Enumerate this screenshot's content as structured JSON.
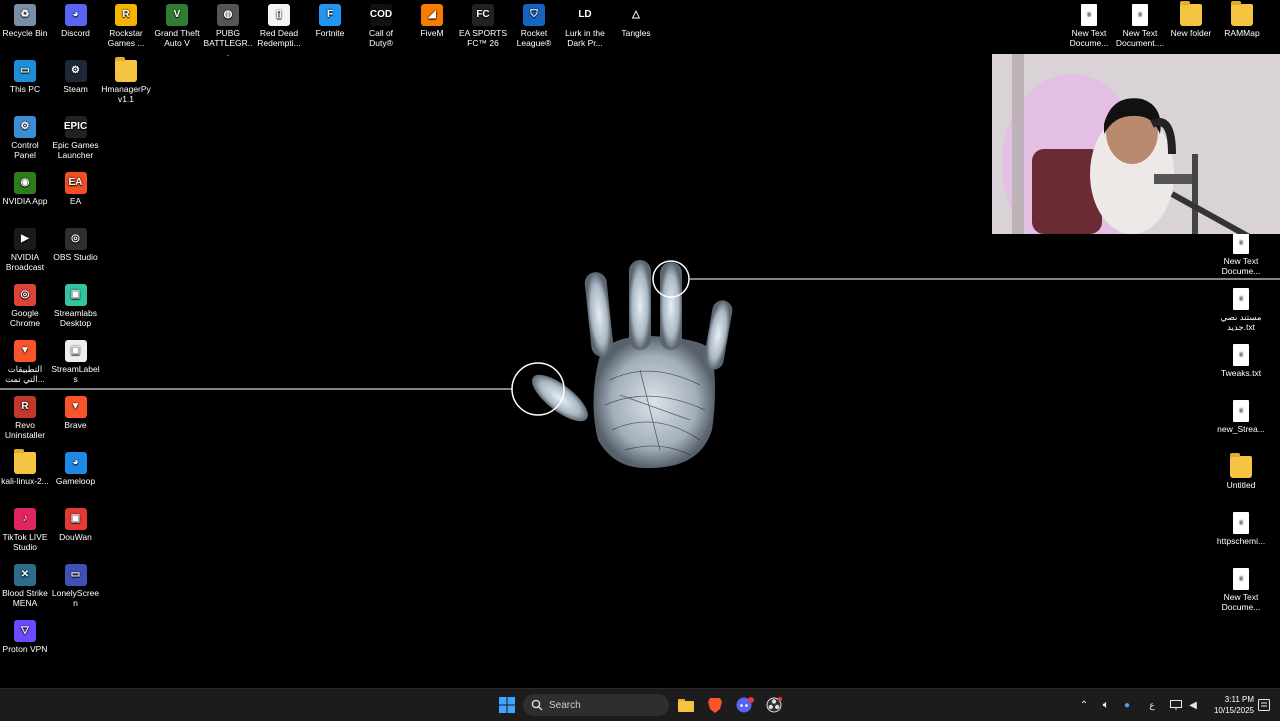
{
  "desktop": {
    "left_columns": [
      [
        {
          "label": "Recycle Bin",
          "icon": "recycle-bin-icon",
          "color": "#7a8fa6",
          "glyph": "♻"
        },
        {
          "label": "This PC",
          "icon": "monitor-icon",
          "color": "#1e8fd6",
          "glyph": "▭"
        },
        {
          "label": "Control Panel",
          "icon": "control-panel-icon",
          "color": "#3b8ed6",
          "glyph": "⚙"
        },
        {
          "label": "NVIDIA App",
          "icon": "nvidia-icon",
          "color": "#2d7d1a",
          "glyph": "◉"
        },
        {
          "label": "NVIDIA Broadcast",
          "icon": "nvidia-broadcast-icon",
          "color": "#1a1a1a",
          "glyph": "▶"
        },
        {
          "label": "Google Chrome",
          "icon": "chrome-icon",
          "color": "#db4437",
          "glyph": "◎"
        },
        {
          "label": "التطبيقات التي تمت...",
          "icon": "brave-apps-icon",
          "color": "#fb542b",
          "glyph": "▼"
        },
        {
          "label": "Revo Uninstaller",
          "icon": "revo-uninstaller-icon",
          "color": "#c0392b",
          "glyph": "R"
        },
        {
          "label": "kali-linux-2...",
          "icon": "folder-icon",
          "color": "#f5c542",
          "glyph": "",
          "folder": true
        },
        {
          "label": "TikTok LIVE Studio",
          "icon": "tiktok-live-icon",
          "color": "#e0245e",
          "glyph": "♪"
        },
        {
          "label": "Blood Strike MENA",
          "icon": "blood-strike-icon",
          "color": "#2b6d8a",
          "glyph": "✕"
        },
        {
          "label": "Proton VPN",
          "icon": "proton-vpn-icon",
          "color": "#6d4aff",
          "glyph": "▽"
        }
      ],
      [
        {
          "label": "Discord",
          "icon": "discord-icon",
          "color": "#5865f2",
          "glyph": "◕"
        },
        {
          "label": "Steam",
          "icon": "steam-icon",
          "color": "#1b2838",
          "glyph": "⚙"
        },
        {
          "label": "Epic Games Launcher",
          "icon": "epic-games-icon",
          "color": "#222",
          "glyph": "EPIC"
        },
        {
          "label": "EA",
          "icon": "ea-icon",
          "color": "#f04e23",
          "glyph": "EA"
        },
        {
          "label": "OBS Studio",
          "icon": "obs-icon",
          "color": "#302e31",
          "glyph": "◎"
        },
        {
          "label": "Streamlabs Desktop",
          "icon": "streamlabs-icon",
          "color": "#31c3a2",
          "glyph": "▣"
        },
        {
          "label": "StreamLabels",
          "icon": "streamlabels-icon",
          "color": "#eeeeee",
          "glyph": "▣"
        },
        {
          "label": "Brave",
          "icon": "brave-icon",
          "color": "#fb542b",
          "glyph": "▼"
        },
        {
          "label": "Gameloop",
          "icon": "gameloop-icon",
          "color": "#1e88e5",
          "glyph": "◕"
        },
        {
          "label": "DouWan",
          "icon": "douwan-icon",
          "color": "#e53935",
          "glyph": "▣"
        },
        {
          "label": "LonelyScreen",
          "icon": "lonelyscreen-icon",
          "color": "#3f51b5",
          "glyph": "▭"
        }
      ],
      [
        {
          "label": "Rockstar Games ...",
          "icon": "rockstar-icon",
          "color": "#f4b400",
          "glyph": "R"
        },
        {
          "label": "HmanagerPy v1.1",
          "icon": "folder-icon",
          "color": "#f5c542",
          "glyph": "",
          "folder": true
        }
      ]
    ],
    "top_row": [
      {
        "label": "Grand Theft Auto V",
        "icon": "gta-v-icon",
        "color": "#2e7d32",
        "glyph": "V"
      },
      {
        "label": "PUBG BATTLEGR...",
        "icon": "pubg-icon",
        "color": "#555",
        "glyph": "◍"
      },
      {
        "label": "Red Dead Redempti...",
        "icon": "red-dead-icon",
        "color": "#f5f5f5",
        "glyph": "▯"
      },
      {
        "label": "Fortnite",
        "icon": "fortnite-icon",
        "color": "#2196f3",
        "glyph": "F"
      },
      {
        "label": "Call of Duty®",
        "icon": "call-of-duty-icon",
        "color": "#111",
        "glyph": "COD"
      },
      {
        "label": "FiveM",
        "icon": "fivem-icon",
        "color": "#f57c00",
        "glyph": "◢"
      },
      {
        "label": "EA SPORTS FC™ 26",
        "icon": "ea-fc-icon",
        "color": "#222",
        "glyph": "FC"
      },
      {
        "label": "Rocket League®",
        "icon": "rocket-league-icon",
        "color": "#1565c0",
        "glyph": "⛉"
      },
      {
        "label": "Lurk in the Dark Pr...",
        "icon": "lurk-icon",
        "color": "#000",
        "glyph": "LD"
      },
      {
        "label": "Tangles",
        "icon": "tangles-icon",
        "color": "#000",
        "glyph": "△"
      }
    ],
    "top_right": [
      {
        "label": "New Text Docume...",
        "icon": "text-file-icon",
        "txt": true
      },
      {
        "label": "New Text Document....",
        "icon": "text-file-icon",
        "txt": true
      },
      {
        "label": "New folder",
        "icon": "folder-icon",
        "folder": true
      },
      {
        "label": "RAMMap",
        "icon": "folder-icon",
        "folder": true
      }
    ],
    "right_column": [
      {
        "label": "New Text Docume...",
        "icon": "text-file-icon",
        "txt": true
      },
      {
        "label": "مستند نصي جديد.txt",
        "icon": "text-file-icon",
        "txt": true
      },
      {
        "label": "Tweaks.txt",
        "icon": "text-file-icon",
        "txt": true
      },
      {
        "label": "new_Strea...",
        "icon": "text-file-icon",
        "txt": true
      },
      {
        "label": "Untitled",
        "icon": "folder-icon",
        "folder": true
      },
      {
        "label": "httpschemi...",
        "icon": "text-file-icon",
        "txt": true
      },
      {
        "label": "New Text Docume...",
        "icon": "text-file-icon",
        "txt": true
      }
    ]
  },
  "taskbar": {
    "search_placeholder": "Search",
    "pinned": [
      {
        "name": "start-button",
        "icon": "windows-logo-icon"
      },
      {
        "name": "file-explorer-button",
        "icon": "folder-icon"
      },
      {
        "name": "brave-taskbar-button",
        "icon": "brave-icon"
      },
      {
        "name": "discord-taskbar-button",
        "icon": "discord-icon"
      },
      {
        "name": "obs-taskbar-button",
        "icon": "obs-icon"
      }
    ],
    "tray": {
      "input_indicator": "ع",
      "time": "3:11 PM",
      "date": "10/15/2025"
    }
  },
  "colors": {
    "desktop_bg": "#000000",
    "taskbar_bg": "#1c1c1c",
    "windows_blue": "#3fa6ff",
    "brave_orange": "#fb542b",
    "discord_blurple": "#5865f2"
  }
}
